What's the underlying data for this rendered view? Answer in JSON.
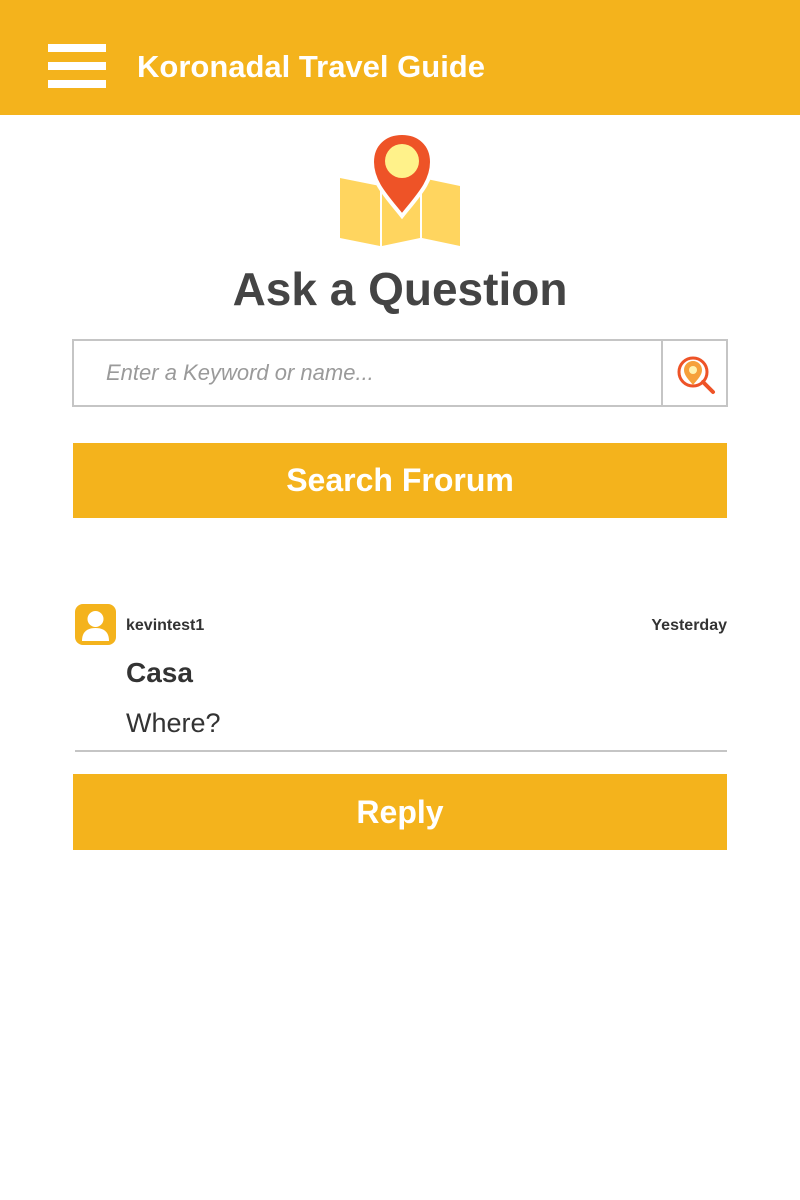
{
  "header": {
    "title": "Koronadal Travel Guide",
    "menu_icon": "hamburger-menu-icon",
    "background_color": "#f4b31c"
  },
  "hero": {
    "icon": "map-pin-icon",
    "title": "Ask a Question"
  },
  "search": {
    "placeholder": "Enter a Keyword or name...",
    "value": "",
    "button_icon": "location-search-icon"
  },
  "search_forum_button": {
    "label": "Search Frorum"
  },
  "post": {
    "author": "kevintest1",
    "time": "Yesterday",
    "title": "Casa",
    "body": "Where?",
    "avatar_icon": "user-avatar-icon"
  },
  "reply_button": {
    "label": "Reply"
  },
  "colors": {
    "accent": "#f4b31c",
    "pin": "#ee5327",
    "map": "#ffd55f",
    "text": "#444444"
  }
}
